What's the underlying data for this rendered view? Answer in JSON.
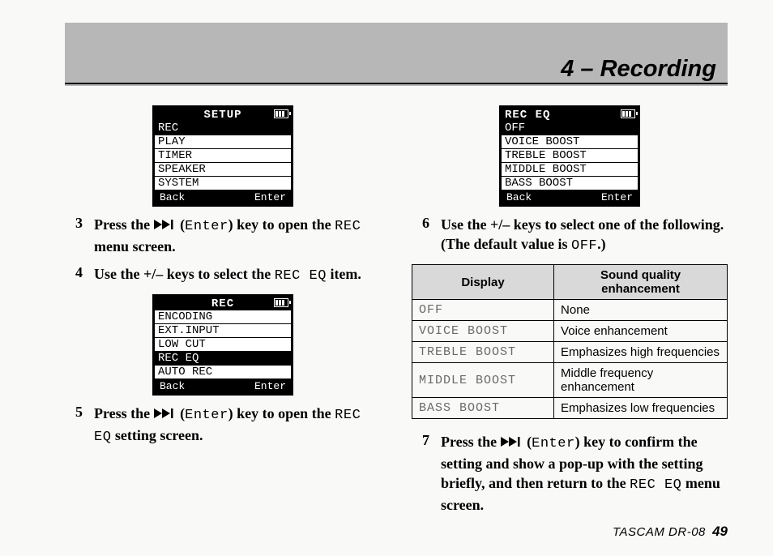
{
  "banner": {
    "title": "4 – Recording"
  },
  "footer": {
    "product": "TASCAM  DR-08",
    "page": "49"
  },
  "glyph": {
    "enter_label": "Enter"
  },
  "lcd": {
    "setup": {
      "title": "SETUP",
      "items": [
        "REC",
        "PLAY",
        "TIMER",
        "SPEAKER",
        "SYSTEM"
      ],
      "selected": 0,
      "back": "Back",
      "enter": "Enter"
    },
    "rec": {
      "title": "REC",
      "items": [
        "ENCODING",
        "EXT.INPUT",
        "LOW CUT",
        "REC EQ",
        "AUTO REC"
      ],
      "selected": 3,
      "back": "Back",
      "enter": "Enter"
    },
    "receq": {
      "title": "REC EQ",
      "items": [
        "OFF",
        "VOICE BOOST",
        "TREBLE BOOST",
        "MIDDLE BOOST",
        "BASS BOOST"
      ],
      "selected": 0,
      "back": "Back",
      "enter": "Enter"
    }
  },
  "steps": {
    "s3": {
      "num": "3",
      "pre": "Press the ",
      "key_open": " (",
      "key_close": ") ",
      "mid": "key to open the ",
      "menu_name": "REC",
      "tail": " menu screen."
    },
    "s4": {
      "num": "4",
      "pre": "Use the +/– keys to select the ",
      "item": "REC EQ",
      "tail": " item."
    },
    "s5": {
      "num": "5",
      "pre": "Press the ",
      "key_open": " (",
      "key_close": ") ",
      "mid": "key to open the ",
      "item": "REC EQ",
      "tail": " setting screen."
    },
    "s6": {
      "num": "6",
      "line1": "Use the +/– keys to select one of the following.",
      "line2_pre": "(The default value is ",
      "line2_val": "OFF",
      "line2_post": ".)"
    },
    "s7": {
      "num": "7",
      "pre": "Press the ",
      "key_open": " (",
      "key_close": ") ",
      "mid": "key to confirm the setting and show a pop-up with the setting briefly, and then return to the ",
      "item": "REC EQ",
      "tail": " menu screen."
    }
  },
  "table": {
    "headers": {
      "display": "Display",
      "desc": "Sound quality enhancement"
    },
    "rows": [
      {
        "display": "OFF",
        "desc": "None"
      },
      {
        "display": "VOICE BOOST",
        "desc": "Voice enhancement"
      },
      {
        "display": "TREBLE BOOST",
        "desc": "Emphasizes high frequencies"
      },
      {
        "display": "MIDDLE BOOST",
        "desc": "Middle frequency enhancement"
      },
      {
        "display": "BASS BOOST",
        "desc": "Emphasizes low frequencies"
      }
    ]
  }
}
